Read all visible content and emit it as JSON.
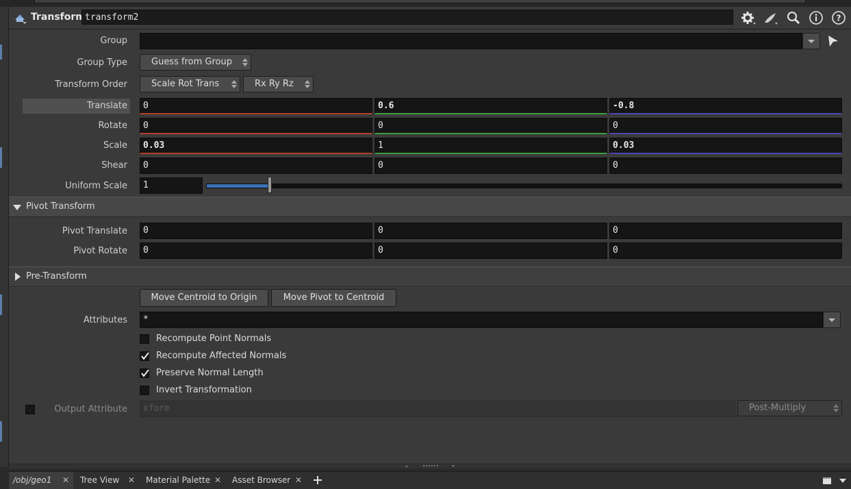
{
  "header": {
    "node_type": "Transform",
    "node_name": "transform2",
    "icons": [
      "gear-icon",
      "brush-icon",
      "search-icon",
      "info-icon",
      "help-icon"
    ]
  },
  "parameters": {
    "group": {
      "label": "Group",
      "value": ""
    },
    "group_type": {
      "label": "Group Type",
      "value": "Guess from Group"
    },
    "transform_order": {
      "label": "Transform Order",
      "value": "Scale Rot Trans",
      "rotation_order": "Rx Ry Rz"
    },
    "translate": {
      "label": "Translate",
      "values": [
        "0",
        "0.6",
        "-0.8"
      ]
    },
    "rotate": {
      "label": "Rotate",
      "values": [
        "0",
        "0",
        "0"
      ]
    },
    "scale": {
      "label": "Scale",
      "values": [
        "0.03",
        "1",
        "0.03"
      ]
    },
    "shear": {
      "label": "Shear",
      "values": [
        "0",
        "0",
        "0"
      ]
    },
    "uniform_scale": {
      "label": "Uniform Scale",
      "value": "1",
      "slider_fraction": 0.1
    }
  },
  "pivot_section": {
    "title": "Pivot Transform",
    "pivot_translate": {
      "label": "Pivot Translate",
      "values": [
        "0",
        "0",
        "0"
      ]
    },
    "pivot_rotate": {
      "label": "Pivot Rotate",
      "values": [
        "0",
        "0",
        "0"
      ]
    }
  },
  "pre_transform_section": {
    "title": "Pre-Transform"
  },
  "buttons": {
    "move_centroid": "Move Centroid to Origin",
    "move_pivot": "Move Pivot to Centroid"
  },
  "attributes": {
    "label": "Attributes",
    "value": "*"
  },
  "checkboxes": [
    {
      "label": "Recompute Point Normals",
      "checked": false
    },
    {
      "label": "Recompute Affected Normals",
      "checked": true
    },
    {
      "label": "Preserve Normal Length",
      "checked": true
    },
    {
      "label": "Invert Transformation",
      "checked": false
    }
  ],
  "output_attribute": {
    "label": "Output Attribute",
    "placeholder": "xform",
    "mode": "Post-Multiply",
    "enabled": false
  },
  "tabs": [
    {
      "label": "/obj/geo1",
      "active": true
    },
    {
      "label": "Tree View",
      "active": false
    },
    {
      "label": "Material Palette",
      "active": false
    },
    {
      "label": "Asset Browser",
      "active": false
    }
  ],
  "colors": {
    "x_axis": "#b3402a",
    "y_axis": "#3c9c3c",
    "z_axis": "#4d46b3",
    "panel_bg": "#3a3a3a",
    "field_bg": "#151515"
  }
}
